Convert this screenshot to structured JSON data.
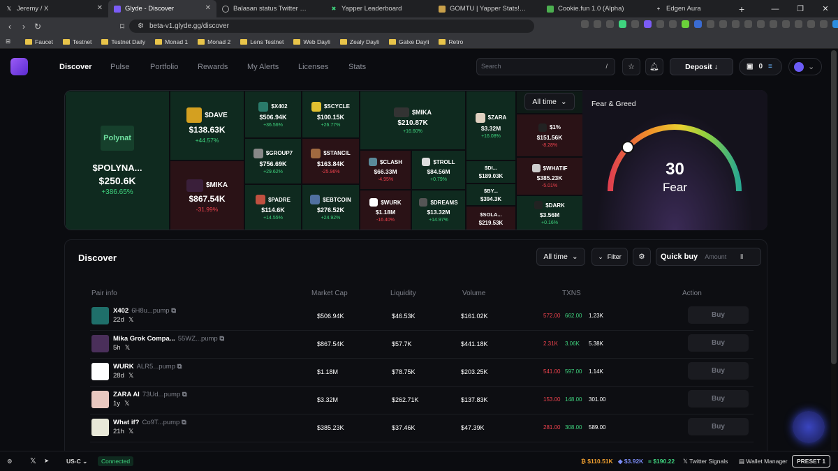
{
  "browser": {
    "tabs": [
      {
        "title": "Jeremy / X",
        "icon": "x-icon"
      },
      {
        "title": "Glyde - Discover",
        "icon": "glyde-icon",
        "active": true
      },
      {
        "title": "Balasan status Twitter VOOI",
        "icon": "globe-icon"
      },
      {
        "title": "Yapper Leaderboard",
        "icon": "yapper-icon"
      },
      {
        "title": "GOMTU | Yapper Stats! | GOMTU",
        "icon": "gomtu-icon"
      },
      {
        "title": "Cookie.fun 1.0 (Alpha)",
        "icon": "cookie-icon"
      },
      {
        "title": "Edgen Aura",
        "icon": "edgen-icon"
      }
    ],
    "url": "beta-v1.glyde.gg/discover",
    "bookmarks": [
      "Faucet",
      "Testnet",
      "Testnet Daily",
      "Monad 1",
      "Monad 2",
      "Lens Testnet",
      "Web Dayli",
      "Zealy Dayli",
      "Galxe Dayli",
      "Retro"
    ]
  },
  "nav": {
    "links": [
      "Discover",
      "Pulse",
      "Portfolio",
      "Rewards",
      "My Alerts",
      "Licenses",
      "Stats"
    ],
    "search_placeholder": "Search",
    "search_shortcut": "/",
    "deposit_label": "Deposit",
    "wallet_count": "0"
  },
  "heatmap": {
    "filter": "All time",
    "cells": [
      {
        "name": "$POLYNA...",
        "value": "$250.6K",
        "pct": "+386.65%",
        "logo_text": "Polynat"
      },
      {
        "name": "$DAVE",
        "value": "$138.63K",
        "pct": "+44.57%"
      },
      {
        "name": "$MIKA",
        "value": "$867.54K",
        "pct": "-31.99%"
      },
      {
        "name": "$X402",
        "value": "$506.94K",
        "pct": "+36.56%"
      },
      {
        "name": "$SCYCLE",
        "value": "$100.15K",
        "pct": "+26.77%"
      },
      {
        "name": "$GROUP7",
        "value": "$756.69K",
        "pct": "+29.62%"
      },
      {
        "name": "$STANCIL",
        "value": "$163.84K",
        "pct": "-25.96%"
      },
      {
        "name": "$PADRE",
        "value": "$114.6K",
        "pct": "+14.55%"
      },
      {
        "name": "$EBTCOIN",
        "value": "$276.52K",
        "pct": "+24.92%"
      },
      {
        "name": "$MIKA",
        "value": "$210.87K",
        "pct": "+16.60%"
      },
      {
        "name": "$CLASH",
        "value": "$66.33M",
        "pct": "-4.95%"
      },
      {
        "name": "$TROLL",
        "value": "$84.56M",
        "pct": "+0.79%"
      },
      {
        "name": "$WURK",
        "value": "$1.18M",
        "pct": "-16.40%"
      },
      {
        "name": "$DREAMS",
        "value": "$13.32M",
        "pct": "+14.97%"
      },
      {
        "name": "$ZARA",
        "value": "$3.32M",
        "pct": "+16.08%"
      },
      {
        "name": "$DI...",
        "value": "$189.03K",
        "pct": ""
      },
      {
        "name": "$BY...",
        "value": "$394.3K",
        "pct": ""
      },
      {
        "name": "$SOLA...",
        "value": "$219.53K",
        "pct": ""
      },
      {
        "name": "$1%",
        "value": "$151.56K",
        "pct": "-8.28%"
      },
      {
        "name": "$WHATIF",
        "value": "$385.23K",
        "pct": "-5.01%"
      },
      {
        "name": "$DARK",
        "value": "$3.56M",
        "pct": "+0.16%"
      }
    ]
  },
  "fear_greed": {
    "title": "Fear & Greed",
    "value": "30",
    "label": "Fear",
    "level": 30
  },
  "discover": {
    "title": "Discover",
    "filter": "All time",
    "filter_btn": "Filter",
    "quick_buy": "Quick buy",
    "amount_placeholder": "Amount",
    "headers": [
      "Pair info",
      "Market Cap",
      "Liquidity",
      "Volume",
      "TXNS",
      "Action"
    ],
    "rows": [
      {
        "name": "X402",
        "addr": "6H8u...pump",
        "age": "22d",
        "mcap": "$506.94K",
        "liq": "$46.53K",
        "vol": "$161.02K",
        "sells": "572.00",
        "buys": "662.00",
        "total": "1.23K",
        "buy": "Buy"
      },
      {
        "name": "Mika Grok Compa...",
        "addr": "55WZ...pump",
        "age": "5h",
        "mcap": "$867.54K",
        "liq": "$57.7K",
        "vol": "$441.18K",
        "sells": "2.31K",
        "buys": "3.06K",
        "total": "5.38K",
        "buy": "Buy"
      },
      {
        "name": "WURK",
        "addr": "ALR5...pump",
        "age": "28d",
        "mcap": "$1.18M",
        "liq": "$78.75K",
        "vol": "$203.25K",
        "sells": "541.00",
        "buys": "597.00",
        "total": "1.14K",
        "buy": "Buy"
      },
      {
        "name": "ZARA AI",
        "addr": "73Ud...pump",
        "age": "1y",
        "mcap": "$3.32M",
        "liq": "$262.71K",
        "vol": "$137.83K",
        "sells": "153.00",
        "buys": "148.00",
        "total": "301.00",
        "buy": "Buy"
      },
      {
        "name": "What if?",
        "addr": "Co9T...pump",
        "age": "21h",
        "mcap": "$385.23K",
        "liq": "$37.46K",
        "vol": "$47.39K",
        "sells": "281.00",
        "buys": "308.00",
        "total": "589.00",
        "buy": "Buy"
      }
    ]
  },
  "statusbar": {
    "region": "US-C",
    "connection": "Connected",
    "btc": "$110.51K",
    "eth": "$3.92K",
    "sol": "$190.22",
    "twitter_signals": "Twitter Signals",
    "wallet_manager": "Wallet Manager",
    "preset": "PRESET 1"
  },
  "colors": {
    "up": "#3fd37e",
    "down": "#f0434e",
    "accent": "#7b5cf6"
  }
}
